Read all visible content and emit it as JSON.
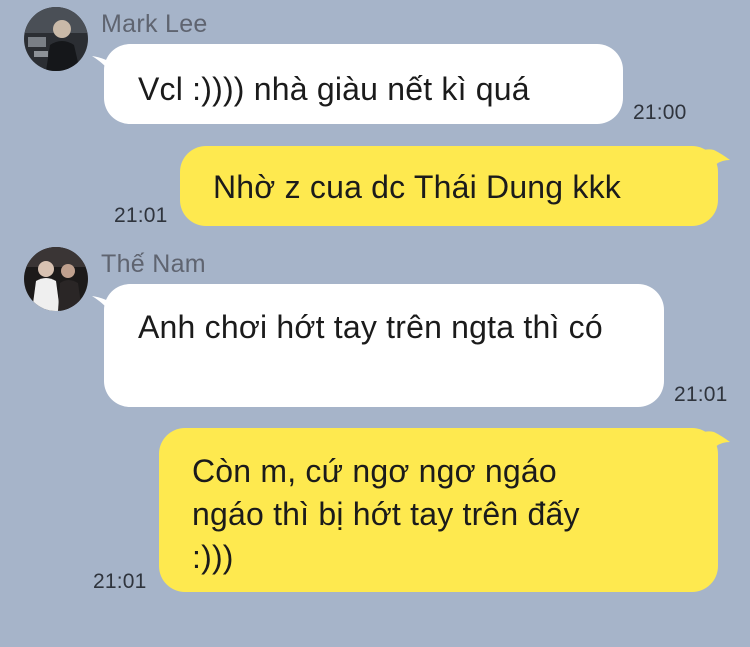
{
  "colors": {
    "background": "#a6b4c9",
    "incoming_bubble": "#ffffff",
    "outgoing_bubble": "#fee94f"
  },
  "messages": [
    {
      "direction": "incoming",
      "sender": "Mark Lee",
      "avatar_icon": "user-avatar-icon",
      "text": "Vcl :)))) nhà giàu nết kì quá",
      "time": "21:00"
    },
    {
      "direction": "outgoing",
      "text": "Nhờ z cua dc Thái Dung kkk",
      "time": "21:01"
    },
    {
      "direction": "incoming",
      "sender": "Thế Nam",
      "avatar_icon": "user-avatar-icon",
      "text": "Anh chơi hớt tay trên ngta thì có",
      "time": "21:01"
    },
    {
      "direction": "outgoing",
      "text": "Còn m, cứ ngơ ngơ ngáo ngáo thì bị hớt tay trên đấy :)))",
      "time": "21:01"
    }
  ]
}
